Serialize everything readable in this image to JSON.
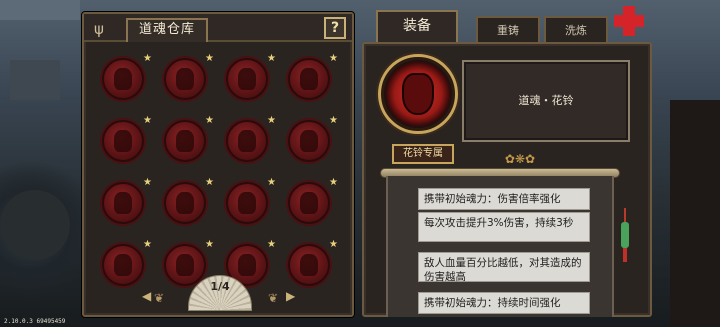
{
  "left_panel": {
    "title": "道魂仓库",
    "help_label": "?",
    "souls_count": 16,
    "pager": {
      "text": "1/4",
      "prev": "◀",
      "next": "▶"
    }
  },
  "right_panel": {
    "tabs": [
      {
        "label": "装备",
        "active": true
      },
      {
        "label": "重铸",
        "active": false
      },
      {
        "label": "洗炼",
        "active": false
      }
    ],
    "item_name": "道魂・花铃",
    "badge": "花铃专属",
    "effects": [
      "携带初始魂力：伤害倍率强化",
      "每次攻击提升3%伤害，持续3秒",
      "敌人血量百分比越低，对其造成的伤害越高",
      "携带初始魂力：持续时间强化"
    ]
  },
  "version": "2.10.0.3 69495459",
  "colors": {
    "panel": "#2a2421",
    "border": "#6b5a3f",
    "accent_red": "#d4242a",
    "gold": "#c8a55d"
  }
}
